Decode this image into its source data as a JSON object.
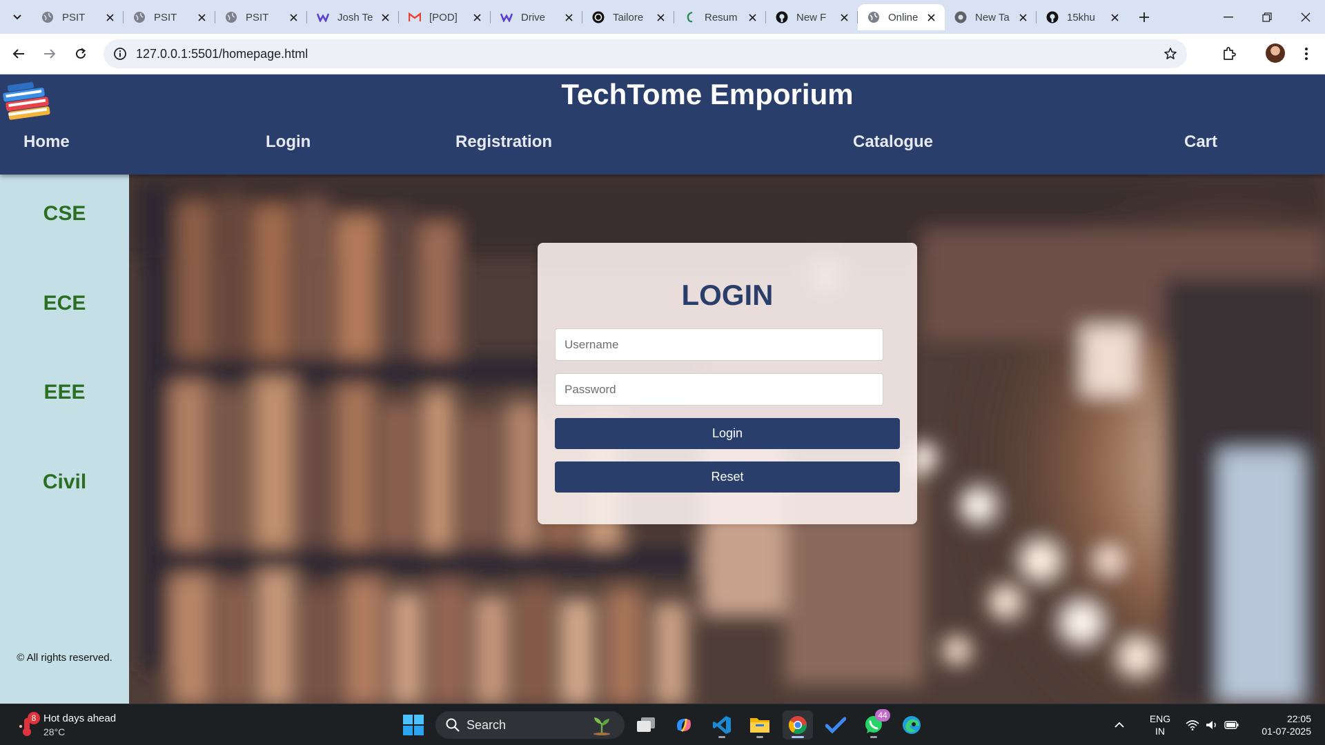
{
  "browser": {
    "tabs": [
      {
        "title": "PSIT",
        "icon": "globe-icon"
      },
      {
        "title": "PSIT",
        "icon": "globe-icon"
      },
      {
        "title": "PSIT",
        "icon": "globe-icon"
      },
      {
        "title": "Josh Te",
        "icon": "josh-icon"
      },
      {
        "title": "[POD]",
        "icon": "gmail-icon"
      },
      {
        "title": "Drive",
        "icon": "drive-icon"
      },
      {
        "title": "Tailore",
        "icon": "openai-icon"
      },
      {
        "title": "Resum",
        "icon": "resume-icon"
      },
      {
        "title": "New F",
        "icon": "github-icon"
      },
      {
        "title": "Online",
        "icon": "globe-icon",
        "active": true
      },
      {
        "title": "New Ta",
        "icon": "chrome-icon"
      },
      {
        "title": "15khu",
        "icon": "github-icon"
      }
    ],
    "url": "127.0.0.1:5501/homepage.html"
  },
  "site": {
    "title": "TechTome Emporium",
    "nav": {
      "home": "Home",
      "login": "Login",
      "registration": "Registration",
      "catalogue": "Catalogue",
      "cart": "Cart"
    },
    "sidebar": [
      "CSE",
      "ECE",
      "EEE",
      "Civil"
    ],
    "copyright": "© All rights reserved."
  },
  "login": {
    "title": "LOGIN",
    "username_placeholder": "Username",
    "password_placeholder": "Password",
    "login_button": "Login",
    "reset_button": "Reset"
  },
  "taskbar": {
    "weather_title": "Hot days ahead",
    "weather_temp": "28°C",
    "weather_badge": "8",
    "search_label": "Search",
    "whatsapp_badge": "44",
    "lang_top": "ENG",
    "lang_bottom": "IN",
    "time": "22:05",
    "date": "01-07-2025"
  },
  "colors": {
    "header": "#2a3e6b",
    "sidebar": "#c5dfe6",
    "sidebar_text": "#2a6e22",
    "button": "#2a3e6b"
  }
}
